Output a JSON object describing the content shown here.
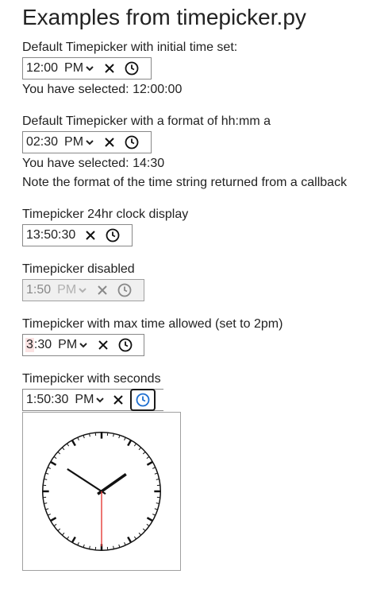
{
  "page": {
    "title": "Examples from timepicker.py"
  },
  "examples": [
    {
      "label": "Default Timepicker with initial time set:",
      "segments": [
        "12",
        "00"
      ],
      "ampm": "PM",
      "result": "You have selected: 12:00:00"
    },
    {
      "label": "Default Timepicker with a format of hh:mm a",
      "segments": [
        "02",
        "30"
      ],
      "ampm": "PM",
      "result": "You have selected: 14:30",
      "note": "Note the format of the time string returned from a callback"
    },
    {
      "label": "Timepicker 24hr clock display",
      "segments": [
        "13",
        "50",
        "30"
      ]
    },
    {
      "label": "Timepicker disabled",
      "segments": [
        "1",
        "50"
      ],
      "ampm": "PM"
    },
    {
      "label": "Timepicker with max time allowed (set to 2pm)",
      "segments": [
        "3",
        "30"
      ],
      "ampm": "PM"
    },
    {
      "label": "Timepicker with seconds",
      "segments": [
        "1",
        "50",
        "30"
      ],
      "ampm": "PM"
    }
  ],
  "analog_clock": {
    "hour": 1,
    "minute": 50,
    "second": 30
  },
  "colors": {
    "active_icon": "#1e6fd0",
    "second_hand": "#e53935",
    "invalid_bg": "#fbe3e3",
    "disabled_text": "#888888"
  },
  "icons": {
    "clear": "close-icon",
    "clock": "clock-icon",
    "dropdown": "chevron-down-icon"
  }
}
